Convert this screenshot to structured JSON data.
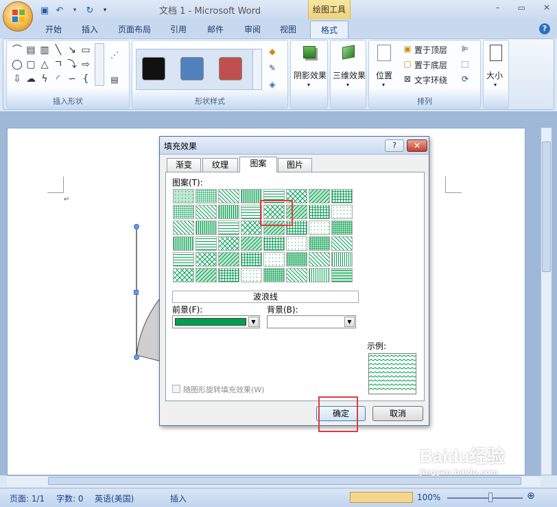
{
  "window": {
    "title": "文档 1 - Microsoft Word",
    "context_tab_group": "绘图工具",
    "controls": [
      "–",
      "▭",
      "✕"
    ]
  },
  "qat": {
    "save": "save-icon",
    "undo": "undo-icon",
    "redo": "redo-icon",
    "customize": "▾"
  },
  "tabs": [
    "开始",
    "插入",
    "页面布局",
    "引用",
    "邮件",
    "审阅",
    "视图"
  ],
  "active_tab": "格式",
  "ribbon": {
    "groups": {
      "insert_shapes": "插入形状",
      "shape_styles": "形状样式",
      "arrange": "排列"
    },
    "shadow_effects": "阴影效果",
    "threed_effects": "三维效果",
    "position": "位置",
    "bring_to_front": "置于顶层",
    "send_to_back": "置于底层",
    "text_wrapping": "文字环绕",
    "size": "大小",
    "style_swatches": [
      "#111111",
      "#4f81bd",
      "#c0504d"
    ]
  },
  "dialog": {
    "title": "填充效果",
    "help": "?",
    "close": "✕",
    "tabs": [
      "渐变",
      "纹理",
      "图案",
      "图片"
    ],
    "active_tab_index": 2,
    "pattern_label": "图案(T):",
    "selected_pattern_name": "波浪线",
    "foreground_label": "前景(F):",
    "foreground_color": "#00a050",
    "background_label": "背景(B):",
    "background_color": "#ffffff",
    "sample_label": "示例:",
    "rotate_checkbox_label": "随图形旋转填充效果(W)",
    "rotate_checked": false,
    "ok_label": "确定",
    "cancel_label": "取消"
  },
  "document": {
    "paragraph_mark": "↵"
  },
  "status": {
    "page": "页面: 1/1",
    "words": "字数: 0",
    "language": "英语(美国)",
    "mode": "插入",
    "zoom": "100%"
  },
  "watermark": {
    "text": "Baidu经验",
    "url": "jingyan.baidu.com"
  }
}
